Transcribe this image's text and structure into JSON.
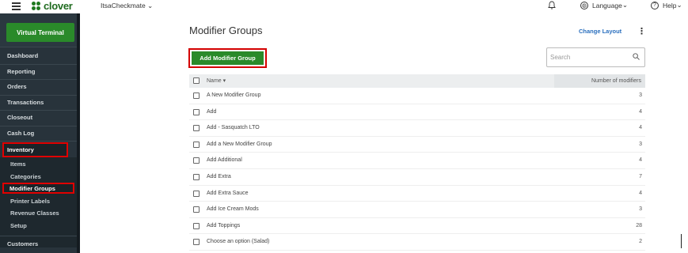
{
  "topbar": {
    "brand": "clover",
    "merchant": "ItsaCheckmate",
    "language": "Language",
    "help": "Help"
  },
  "sidebar": {
    "virtual_terminal": "Virtual Terminal",
    "items": [
      {
        "label": "Dashboard"
      },
      {
        "label": "Reporting"
      },
      {
        "label": "Orders"
      },
      {
        "label": "Transactions"
      },
      {
        "label": "Closeout"
      },
      {
        "label": "Cash Log"
      },
      {
        "label": "Inventory"
      }
    ],
    "sub_items": [
      {
        "label": "Items"
      },
      {
        "label": "Categories"
      },
      {
        "label": "Modifier Groups"
      },
      {
        "label": "Printer Labels"
      },
      {
        "label": "Revenue Classes"
      },
      {
        "label": "Setup"
      }
    ],
    "customers": "Customers"
  },
  "main": {
    "title": "Modifier Groups",
    "change_layout": "Change Layout",
    "add_button": "Add Modifier Group",
    "search_placeholder": "Search",
    "columns": {
      "name": "Name",
      "count": "Number of modifiers"
    },
    "rows": [
      {
        "name": "A New Modifier Group",
        "count": "3"
      },
      {
        "name": "Add",
        "count": "4"
      },
      {
        "name": "Add - Sasquatch LTO",
        "count": "4"
      },
      {
        "name": "Add a New Modifier Group",
        "count": "3"
      },
      {
        "name": "Add Additional",
        "count": "4"
      },
      {
        "name": "Add Extra",
        "count": "7"
      },
      {
        "name": "Add Extra Sauce",
        "count": "4"
      },
      {
        "name": "Add Ice Cream Mods",
        "count": "3"
      },
      {
        "name": "Add Toppings",
        "count": "28"
      },
      {
        "name": "Choose an option (Salad)",
        "count": "2"
      }
    ]
  },
  "colors": {
    "brand_green": "#2a8a2a",
    "sidebar": "#28333b",
    "highlight": "#e00000",
    "link": "#2a6fbe"
  }
}
